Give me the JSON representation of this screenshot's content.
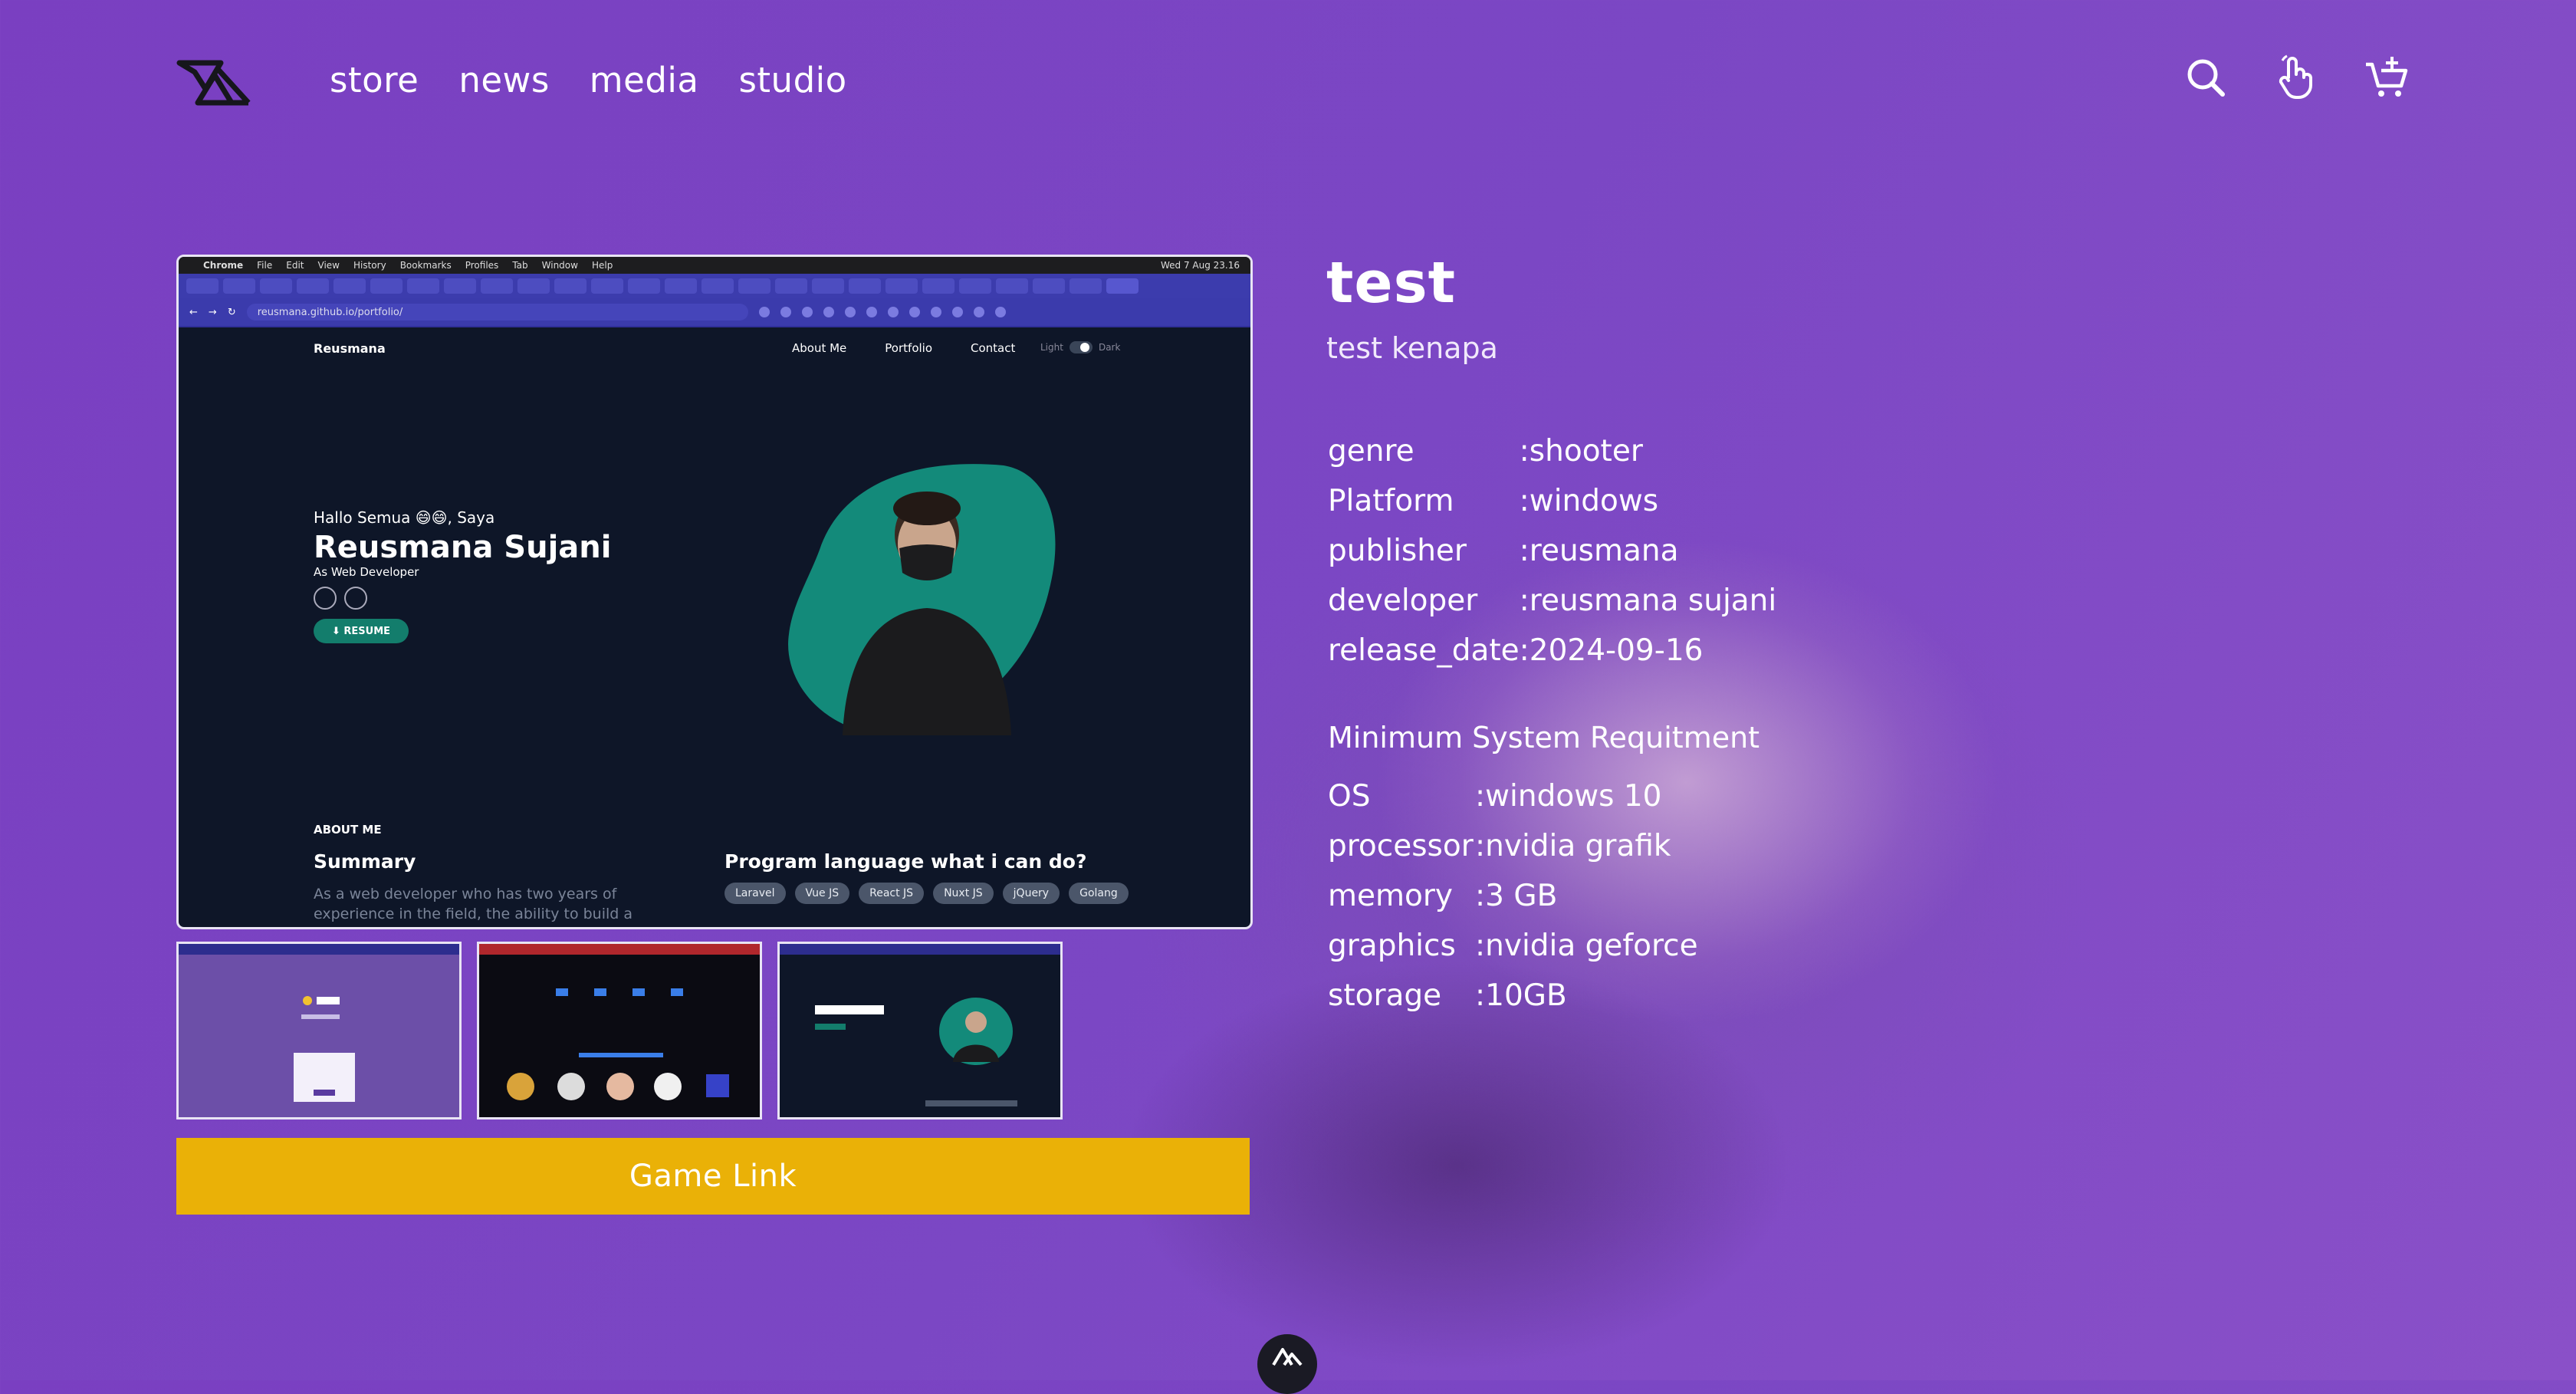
{
  "nav": {
    "links": [
      "store",
      "news",
      "media",
      "studio"
    ],
    "icons": [
      "search-icon",
      "hand-pointer-icon",
      "cart-add-icon"
    ]
  },
  "screenshot": {
    "menubar": {
      "items": [
        "Chrome",
        "File",
        "Edit",
        "View",
        "History",
        "Bookmarks",
        "Profiles",
        "Tab",
        "Window",
        "Help"
      ],
      "clock": "Wed 7 Aug 23.16"
    },
    "url": "reusmana.github.io/portfolio/",
    "site": {
      "brand": "Reusmana",
      "menu": [
        "About Me",
        "Portfolio",
        "Contact"
      ],
      "toggle_light": "Light",
      "toggle_dark": "Dark",
      "greeting": "Hallo Semua 😄😄, Saya",
      "name": "Reusmana Sujani",
      "role": "As Web Developer",
      "resume": "⬇ RESUME",
      "about_label": "ABOUT ME",
      "summary_title": "Summary",
      "summary_text": "As a web developer who has two years of experience in the field, the ability to build a",
      "program_title": "Program language what i can do?",
      "chips": [
        "Laravel",
        "Vue JS",
        "React JS",
        "Nuxt JS",
        "jQuery",
        "Golang"
      ]
    }
  },
  "thumbnails": [
    {
      "label": "thumbnail-1"
    },
    {
      "label": "thumbnail-2"
    },
    {
      "label": "thumbnail-3"
    }
  ],
  "game_link": "Game Link",
  "game": {
    "title": "test",
    "subtitle": "test kenapa",
    "info": [
      {
        "key": "genre",
        "value": ":shooter"
      },
      {
        "key": "Platform",
        "value": ":windows"
      },
      {
        "key": "publisher",
        "value": ":reusmana"
      },
      {
        "key": "developer",
        "value": ":reusmana sujani"
      },
      {
        "key": "release_date",
        "value": ":2024-09-16"
      }
    ],
    "requirements_title": "Minimum System Requitment",
    "requirements": [
      {
        "key": "OS",
        "value": ":windows 10"
      },
      {
        "key": "processor",
        "value": ":nvidia grafik"
      },
      {
        "key": "memory",
        "value": ":3 GB"
      },
      {
        "key": "graphics",
        "value": ":nvidia geforce"
      },
      {
        "key": "storage",
        "value": ":10GB"
      }
    ]
  },
  "colors": {
    "background": "#7b47c4",
    "button": "#eab107",
    "site_bg": "#0e1628",
    "accent_teal": "#137d6c"
  }
}
